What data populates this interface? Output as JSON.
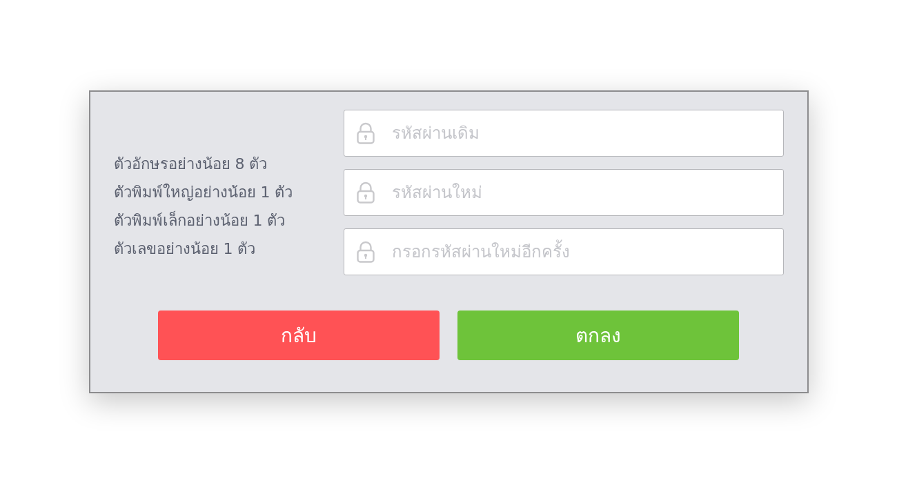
{
  "dialog": {
    "requirements": [
      "ตัวอักษรอย่างน้อย 8 ตัว",
      "ตัวพิมพ์ใหญ่อย่างน้อย 1 ตัว",
      "ตัวพิมพ์เล็กอย่างน้อย 1 ตัว",
      "ตัวเลขอย่างน้อย 1 ตัว"
    ],
    "fields": [
      {
        "placeholder": "รหัสผ่านเดิม"
      },
      {
        "placeholder": "รหัสผ่านใหม่"
      },
      {
        "placeholder": "กรอกรหัสผ่านใหม่อีกครั้ง"
      }
    ],
    "buttons": [
      {
        "label": "กลับ",
        "kind": "back"
      },
      {
        "label": "ตกลง",
        "kind": "confirm"
      }
    ]
  }
}
